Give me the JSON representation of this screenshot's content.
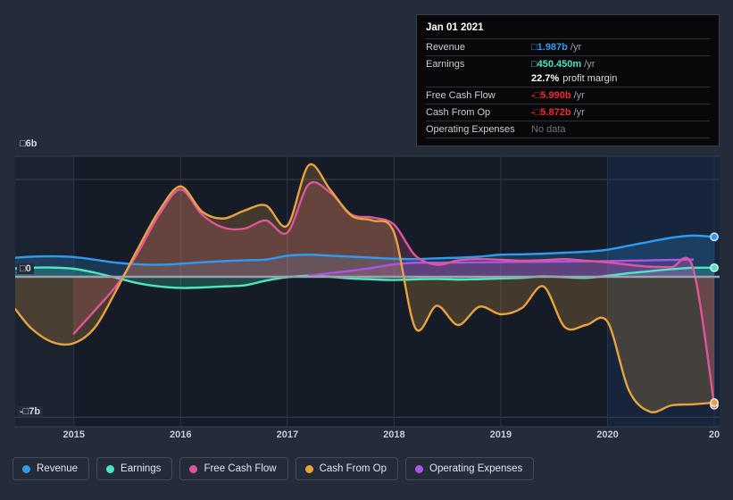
{
  "tooltip": {
    "date": "Jan 01 2021",
    "rows": [
      {
        "label": "Revenue",
        "value": "□1.987b",
        "unit": "/yr",
        "color": "#2e9bf0"
      },
      {
        "label": "Earnings",
        "value": "□450.450m",
        "unit": "/yr",
        "color": "#4be8c0"
      },
      {
        "label": "Free Cash Flow",
        "value": "-□5.990b",
        "unit": "/yr",
        "color": "#ef2b2b"
      },
      {
        "label": "Cash From Op",
        "value": "-□5.872b",
        "unit": "/yr",
        "color": "#ef2b2b"
      },
      {
        "label": "Operating Expenses",
        "value": "No data",
        "unit": "",
        "color": "#6f7480"
      }
    ],
    "profit_margin_value": "22.7%",
    "profit_margin_text": "profit margin"
  },
  "legend": {
    "items": [
      {
        "label": "Revenue",
        "color": "#2e9bf0"
      },
      {
        "label": "Earnings",
        "color": "#4be8c0"
      },
      {
        "label": "Free Cash Flow",
        "color": "#e0559a"
      },
      {
        "label": "Cash From Op",
        "color": "#e8a33d"
      },
      {
        "label": "Operating Expenses",
        "color": "#a855e8"
      }
    ]
  },
  "chart_data": {
    "type": "area",
    "title": "",
    "xlabel": "",
    "ylabel": "",
    "ylim": [
      -7,
      6
    ],
    "y_ticks": [
      {
        "value": 6,
        "label": "□6b"
      },
      {
        "value": 0,
        "label": "□0"
      },
      {
        "value": -7,
        "label": "-□7b"
      }
    ],
    "x_ticks": [
      {
        "value": 2015,
        "label": "2015"
      },
      {
        "value": 2016,
        "label": "2016"
      },
      {
        "value": 2017,
        "label": "2017"
      },
      {
        "value": 2018,
        "label": "2018"
      },
      {
        "value": 2019,
        "label": "2019"
      },
      {
        "value": 2020,
        "label": "2020"
      },
      {
        "value": 2021,
        "label": "20"
      }
    ],
    "grid": true,
    "legend_position": "bottom",
    "forecast_start": 2020.0,
    "x": [
      2014.45,
      2014.6,
      2014.8,
      2015.0,
      2015.2,
      2015.4,
      2015.6,
      2015.8,
      2016.0,
      2016.2,
      2016.4,
      2016.6,
      2016.8,
      2017.0,
      2017.2,
      2017.4,
      2017.6,
      2017.8,
      2018.0,
      2018.2,
      2018.4,
      2018.6,
      2018.8,
      2019.0,
      2019.2,
      2019.4,
      2019.6,
      2019.8,
      2020.0,
      2020.2,
      2020.4,
      2020.6,
      2020.8,
      2021.0
    ],
    "series": [
      {
        "name": "Revenue",
        "color": "#2e9bf0",
        "values": [
          0.95,
          1.0,
          1.02,
          0.98,
          0.85,
          0.7,
          0.62,
          0.6,
          0.65,
          0.72,
          0.78,
          0.82,
          0.86,
          1.05,
          1.1,
          1.05,
          1.0,
          0.95,
          0.9,
          0.88,
          0.92,
          0.95,
          1.0,
          1.1,
          1.12,
          1.15,
          1.2,
          1.25,
          1.35,
          1.55,
          1.75,
          1.95,
          2.05,
          1.987
        ]
      },
      {
        "name": "Earnings",
        "color": "#4be8c0",
        "values": [
          0.42,
          0.45,
          0.46,
          0.4,
          0.2,
          -0.05,
          -0.3,
          -0.45,
          -0.52,
          -0.5,
          -0.45,
          -0.4,
          -0.18,
          -0.02,
          0.05,
          0.0,
          -0.08,
          -0.12,
          -0.15,
          -0.12,
          -0.1,
          -0.13,
          -0.11,
          -0.08,
          -0.05,
          0.02,
          -0.02,
          -0.05,
          0.05,
          0.18,
          0.28,
          0.38,
          0.45,
          0.45
        ]
      },
      {
        "name": "Free Cash Flow",
        "color": "#e0559a",
        "values": [
          null,
          null,
          null,
          -2.65,
          -1.55,
          -0.4,
          1.2,
          3.1,
          4.35,
          3.1,
          2.45,
          2.4,
          2.8,
          2.2,
          4.6,
          4.2,
          3.1,
          2.95,
          2.6,
          1.05,
          0.6,
          0.82,
          0.88,
          0.85,
          0.8,
          0.83,
          0.88,
          0.8,
          0.72,
          0.6,
          0.5,
          0.48,
          0.45,
          -5.99
        ]
      },
      {
        "name": "Cash From Op",
        "color": "#e8a33d",
        "values": [
          -1.5,
          -2.4,
          -3.05,
          -3.1,
          -2.35,
          -0.6,
          1.4,
          3.3,
          4.5,
          3.25,
          2.9,
          3.3,
          3.55,
          2.55,
          5.55,
          4.35,
          3.05,
          2.8,
          2.2,
          -2.4,
          -1.35,
          -2.25,
          -1.4,
          -1.75,
          -1.45,
          -0.45,
          -2.35,
          -2.25,
          -2.1,
          -5.3,
          -6.3,
          -6.0,
          -5.95,
          -5.872
        ]
      },
      {
        "name": "Operating Expenses",
        "color": "#a855e8",
        "values": [
          null,
          null,
          null,
          null,
          null,
          null,
          null,
          null,
          null,
          null,
          null,
          null,
          null,
          null,
          0.05,
          0.18,
          0.3,
          0.45,
          0.62,
          0.7,
          0.7,
          0.71,
          0.72,
          0.73,
          0.74,
          0.75,
          0.76,
          0.77,
          0.78,
          0.8,
          0.82,
          0.84,
          0.86,
          null
        ]
      }
    ]
  }
}
